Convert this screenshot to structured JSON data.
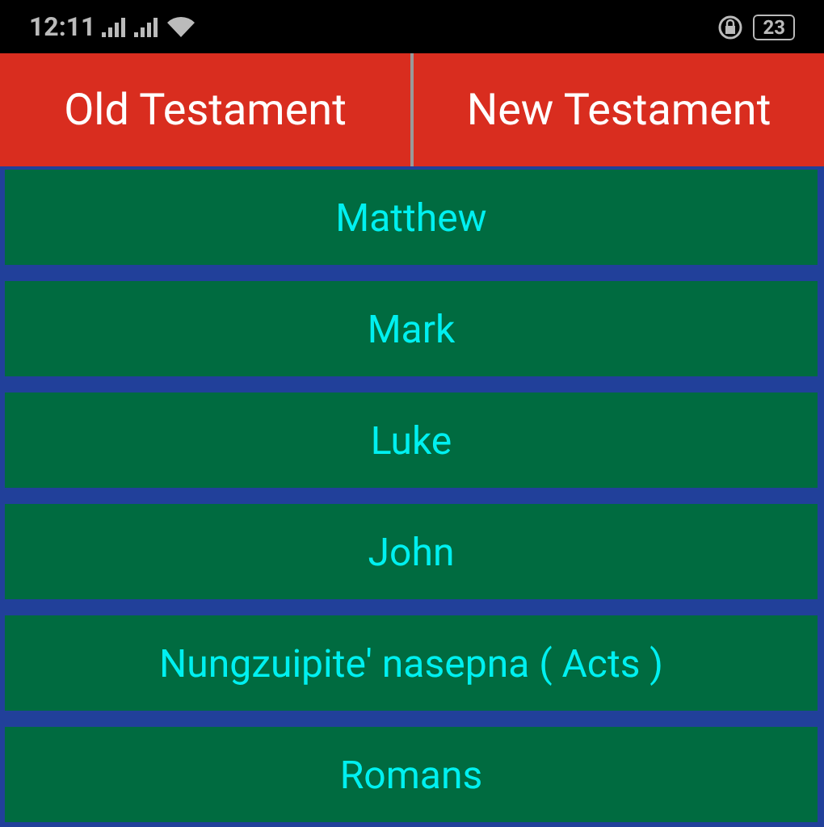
{
  "status_bar": {
    "time": "12:11",
    "battery": "23"
  },
  "tabs": [
    {
      "label": "Old Testament"
    },
    {
      "label": "New Testament"
    }
  ],
  "books": [
    {
      "label": "Matthew"
    },
    {
      "label": "Mark"
    },
    {
      "label": "Luke"
    },
    {
      "label": "John"
    },
    {
      "label": "Nungzuipite' nasepna ( Acts )"
    },
    {
      "label": "Romans"
    }
  ]
}
